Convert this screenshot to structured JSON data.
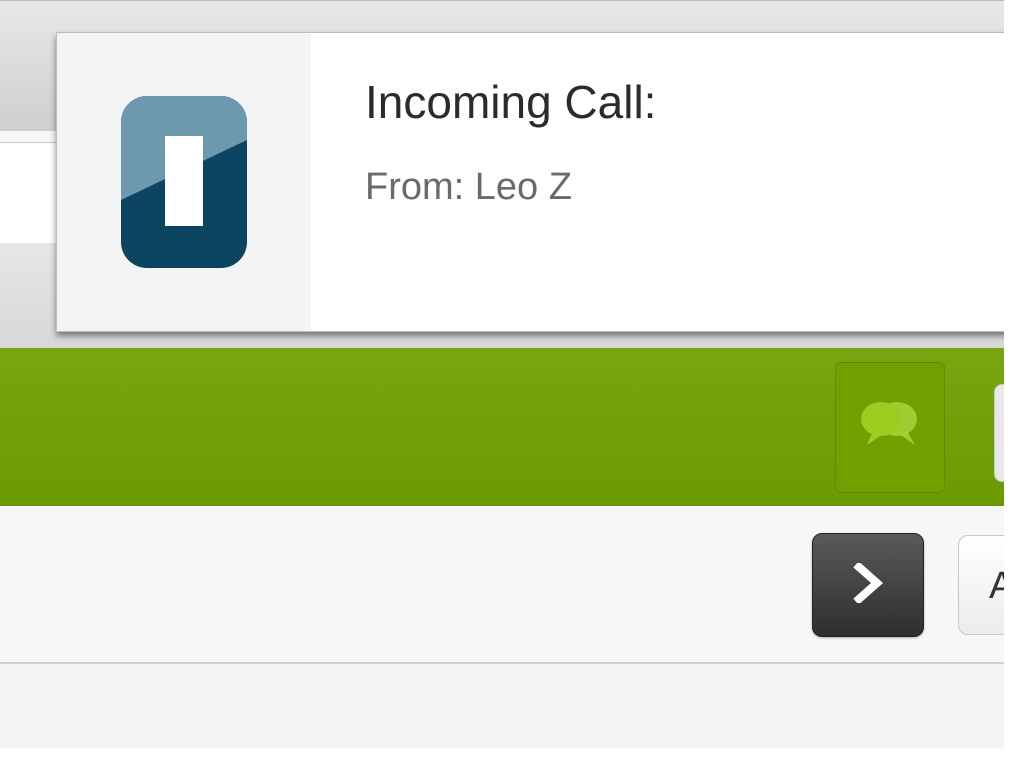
{
  "notification": {
    "title": "Incoming Call:",
    "subtitle": "From: Leo Z",
    "app_icon": "app-logo-icon"
  },
  "appbar": {
    "chat_icon": "chat-bubbles-icon",
    "accent_color": "#73a20a"
  },
  "toolbar": {
    "next_icon": "chevron-right-icon",
    "partial_button_label": "A"
  }
}
